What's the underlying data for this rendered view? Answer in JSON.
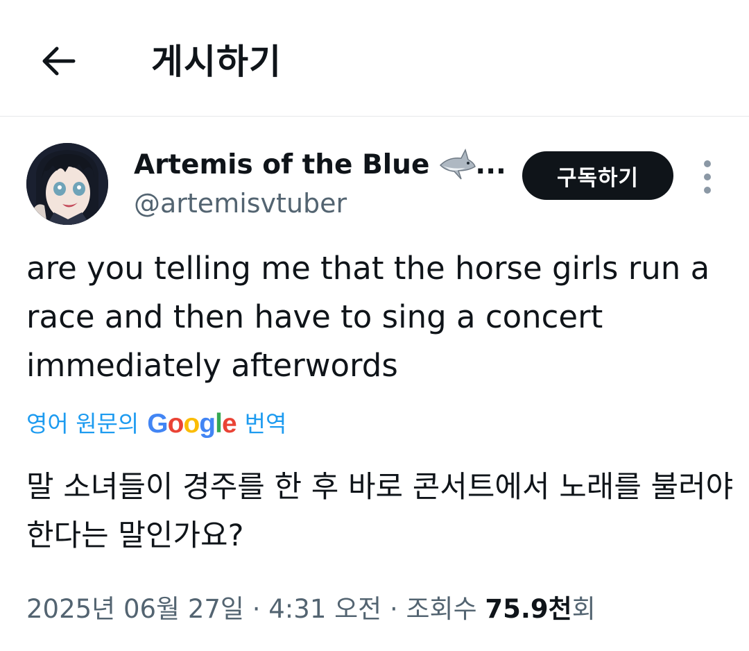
{
  "header": {
    "title": "게시하기"
  },
  "author": {
    "display_name": "Artemis of the Blue",
    "ellipsis": "...",
    "handle": "@artemisvtuber",
    "subscribe_label": "구독하기"
  },
  "tweet": {
    "text": "are you telling me that the horse girls run a race and then have to sing a concert immediately afterwords"
  },
  "translation": {
    "prefix": "영어 원문의",
    "google": [
      "G",
      "o",
      "o",
      "g",
      "l",
      "e"
    ],
    "suffix": "번역",
    "text": "말 소녀들이 경주를 한 후 바로 콘서트에서 노래를 불러야 한다는 말인가요?"
  },
  "meta": {
    "date": "2025년 06월 27일",
    "separator": "·",
    "time": "4:31 오전",
    "views_label": "조회수",
    "views_count": "75.9천",
    "views_suffix": "회"
  },
  "colors": {
    "link": "#1d9bf0",
    "secondary": "#536471",
    "primary": "#0f1419",
    "google_blue": "#4285F4",
    "google_red": "#EA4335",
    "google_yellow": "#FBBC05",
    "google_green": "#34A853"
  },
  "icons": {
    "back": "arrow-left-icon",
    "shark": "shark-emoji-icon",
    "more": "more-vertical-icon"
  }
}
